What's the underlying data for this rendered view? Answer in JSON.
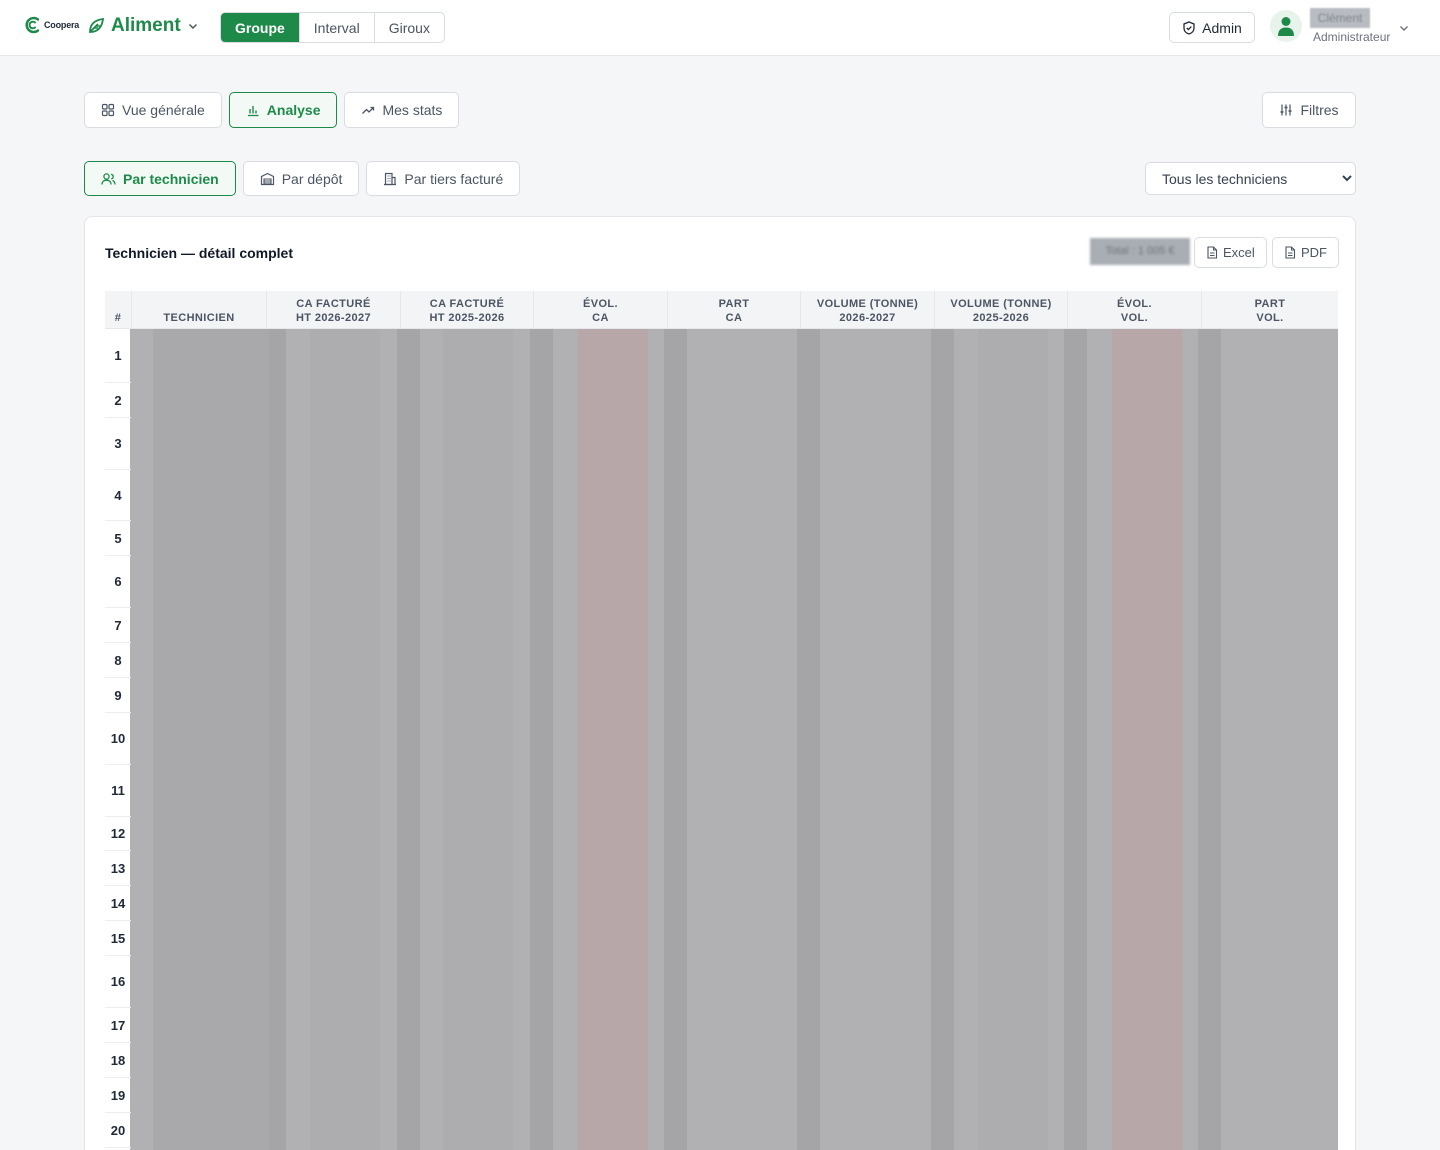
{
  "brand": {
    "logo_text": "Coopera",
    "app_name": "Aliment"
  },
  "entity_tabs": [
    {
      "label": "Groupe",
      "active": true
    },
    {
      "label": "Interval",
      "active": false
    },
    {
      "label": "Giroux",
      "active": false
    }
  ],
  "header": {
    "admin_label": "Admin",
    "user_name": "Clément",
    "user_role": "Administrateur"
  },
  "view_tabs": [
    {
      "label": "Vue générale",
      "icon": "grid-icon",
      "active": false
    },
    {
      "label": "Analyse",
      "icon": "bar-chart-icon",
      "active": true
    },
    {
      "label": "Mes stats",
      "icon": "trend-up-icon",
      "active": false
    }
  ],
  "filters_label": "Filtres",
  "sub_tabs": [
    {
      "label": "Par technicien",
      "icon": "users-icon",
      "active": true
    },
    {
      "label": "Par dépôt",
      "icon": "warehouse-icon",
      "active": false
    },
    {
      "label": "Par tiers facturé",
      "icon": "building-icon",
      "active": false
    }
  ],
  "technician_select": {
    "value": "Tous les techniciens"
  },
  "card": {
    "title": "Technicien — détail complet",
    "total_text": "Total : 1 005 €",
    "excel_label": "Excel",
    "pdf_label": "PDF"
  },
  "table": {
    "columns": [
      [
        "#",
        ""
      ],
      [
        "TECHNICIEN",
        ""
      ],
      [
        "CA FACTURÉ",
        "HT 2026-2027"
      ],
      [
        "CA FACTURÉ",
        "HT 2025-2026"
      ],
      [
        "ÉVOL.",
        "CA"
      ],
      [
        "PART",
        "CA"
      ],
      [
        "VOLUME (TONNE)",
        "2026-2027"
      ],
      [
        "VOLUME (TONNE)",
        "2025-2026"
      ],
      [
        "ÉVOL.",
        "VOL."
      ],
      [
        "PART",
        "VOL."
      ]
    ],
    "row_numbers": [
      "1",
      "2",
      "3",
      "4",
      "5",
      "6",
      "7",
      "8",
      "9",
      "10",
      "11",
      "12",
      "13",
      "14",
      "15",
      "16",
      "17",
      "18",
      "19",
      "20"
    ],
    "accent_colors": {
      "green": "#1e8a4a",
      "redacted": "#b1b1b3",
      "negative": "#c98a8a"
    }
  }
}
